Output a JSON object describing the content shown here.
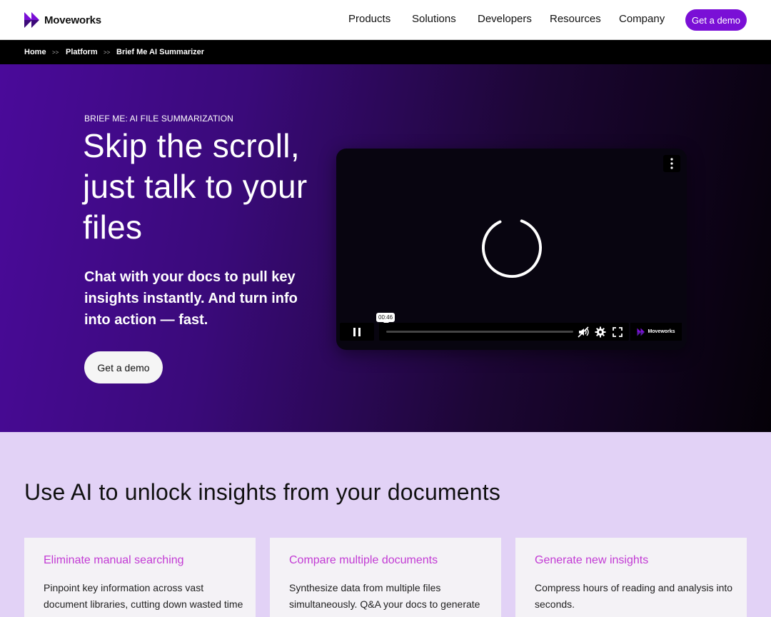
{
  "nav": {
    "brand": "Moveworks",
    "items": [
      "Products",
      "Solutions",
      "Developers",
      "Resources",
      "Company"
    ],
    "cta": "Get a demo"
  },
  "breadcrumb": {
    "items": [
      "Home",
      "Platform",
      "Brief Me AI Summarizer"
    ],
    "separator": ">>"
  },
  "hero": {
    "eyebrow": "BRIEF ME: AI FILE SUMMARIZATION",
    "title": "Skip the scroll, just talk to your files",
    "subtitle": "Chat with your docs to pull key insights instantly. And turn info into action — fast.",
    "cta": "Get a demo"
  },
  "video": {
    "time_tooltip": "00:46",
    "progress": 0.0,
    "brand": "Moveworks"
  },
  "lower": {
    "title": "Use AI to unlock insights from your documents",
    "cards": [
      {
        "title": "Eliminate manual searching",
        "body": "Pinpoint key information across vast document libraries, cutting down wasted time"
      },
      {
        "title": "Compare multiple documents",
        "body": "Synthesize data from multiple files simultaneously. Q&A your docs to generate"
      },
      {
        "title": "Generate new insights",
        "body": "Compress hours of reading and analysis into seconds."
      }
    ]
  },
  "colors": {
    "brand_purple": "#7a0fd6",
    "card_title": "#c23bd4",
    "section_bg": "#e2d2f6"
  }
}
